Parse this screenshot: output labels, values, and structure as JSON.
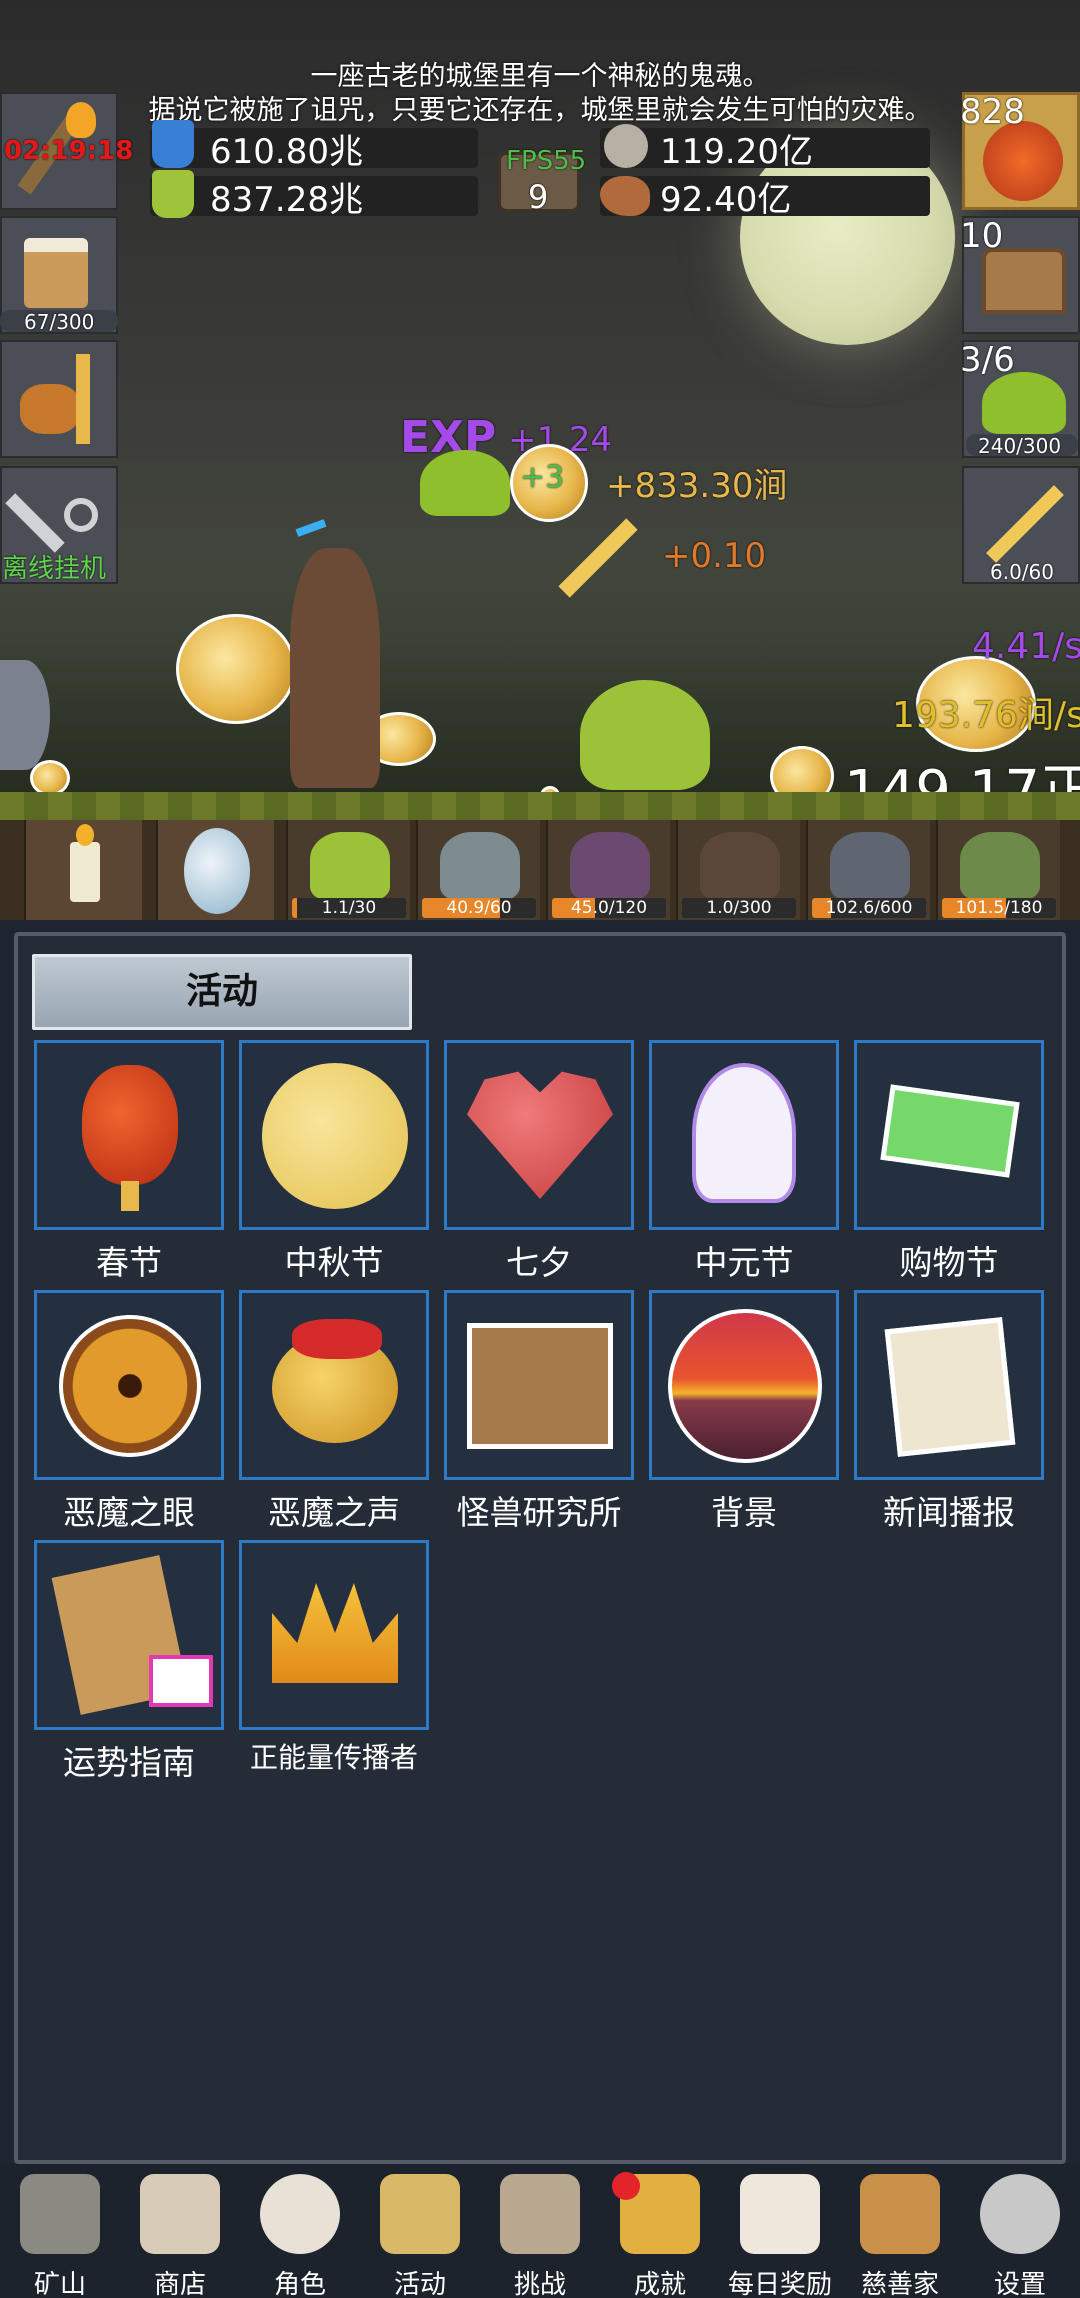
{
  "story": {
    "line1": "一座古老的城堡里有一个神秘的鬼魂。",
    "line2": "据说它被施了诅咒，只要它还存在，城堡里就会发生可怕的灾难。"
  },
  "resources": {
    "blue_potion": "610.80兆",
    "green_potion": "837.28兆",
    "silver_coin": "119.20亿",
    "meat": "92.40亿",
    "fps": "FPS55",
    "chest_count": "9"
  },
  "left_side": {
    "timer": "02:19:18",
    "beer_progress": "67/300",
    "offline_label": "离线挂机"
  },
  "right_side": {
    "potion_count": "828",
    "chest_count": "10",
    "slime_count": "3/6",
    "slime_progress": "240/300",
    "sword_progress": "6.0/60"
  },
  "floats": {
    "exp": "+1.24",
    "coin_bonus": "+3",
    "gold_gain": "+833.30涧",
    "attack_gain": "+0.10",
    "rate_purple": "4.41/s",
    "rate_gold": "193.76涧/s",
    "total": "149.17正"
  },
  "monsters": [
    {
      "progress": "1.1/30",
      "fill": 0.04
    },
    {
      "progress": "40.9/60",
      "fill": 0.68
    },
    {
      "progress": "45.0/120",
      "fill": 0.38
    },
    {
      "progress": "1.0/300",
      "fill": 0.0
    },
    {
      "progress": "102.6/600",
      "fill": 0.17
    },
    {
      "progress": "101.5/180",
      "fill": 0.56
    }
  ],
  "panel": {
    "title": "活动",
    "items": [
      {
        "label": "春节",
        "icon": "lantern-icon"
      },
      {
        "label": "中秋节",
        "icon": "moon-icon"
      },
      {
        "label": "七夕",
        "icon": "heart-icon"
      },
      {
        "label": "中元节",
        "icon": "ghost-icon"
      },
      {
        "label": "购物节",
        "icon": "cash-icon"
      },
      {
        "label": "恶魔之眼",
        "icon": "demon-eye-icon"
      },
      {
        "label": "恶魔之声",
        "icon": "bell-icon"
      },
      {
        "label": "怪兽研究所",
        "icon": "lab-icon"
      },
      {
        "label": "背景",
        "icon": "sunset-icon"
      },
      {
        "label": "新闻播报",
        "icon": "news-icon"
      },
      {
        "label": "运势指南",
        "icon": "fortune-icon"
      },
      {
        "label": "正能量传播者",
        "icon": "crown-icon"
      }
    ]
  },
  "nav": [
    {
      "label": "矿山",
      "icon": "lantern-nav-icon"
    },
    {
      "label": "商店",
      "icon": "shell-icon"
    },
    {
      "label": "角色",
      "icon": "skull-icon"
    },
    {
      "label": "活动",
      "icon": "scroll-icon"
    },
    {
      "label": "挑战",
      "icon": "map-icon"
    },
    {
      "label": "成就",
      "icon": "key-icon"
    },
    {
      "label": "每日奖励",
      "icon": "letter-icon"
    },
    {
      "label": "慈善家",
      "icon": "bread-icon"
    },
    {
      "label": "设置",
      "icon": "gear-icon"
    }
  ],
  "colors": {
    "panel_bg": "#242c38",
    "item_border": "#2f7ac6",
    "gold_text": "#e9b84a",
    "purple_text": "#a34ae8",
    "timer_red": "#e41818"
  }
}
